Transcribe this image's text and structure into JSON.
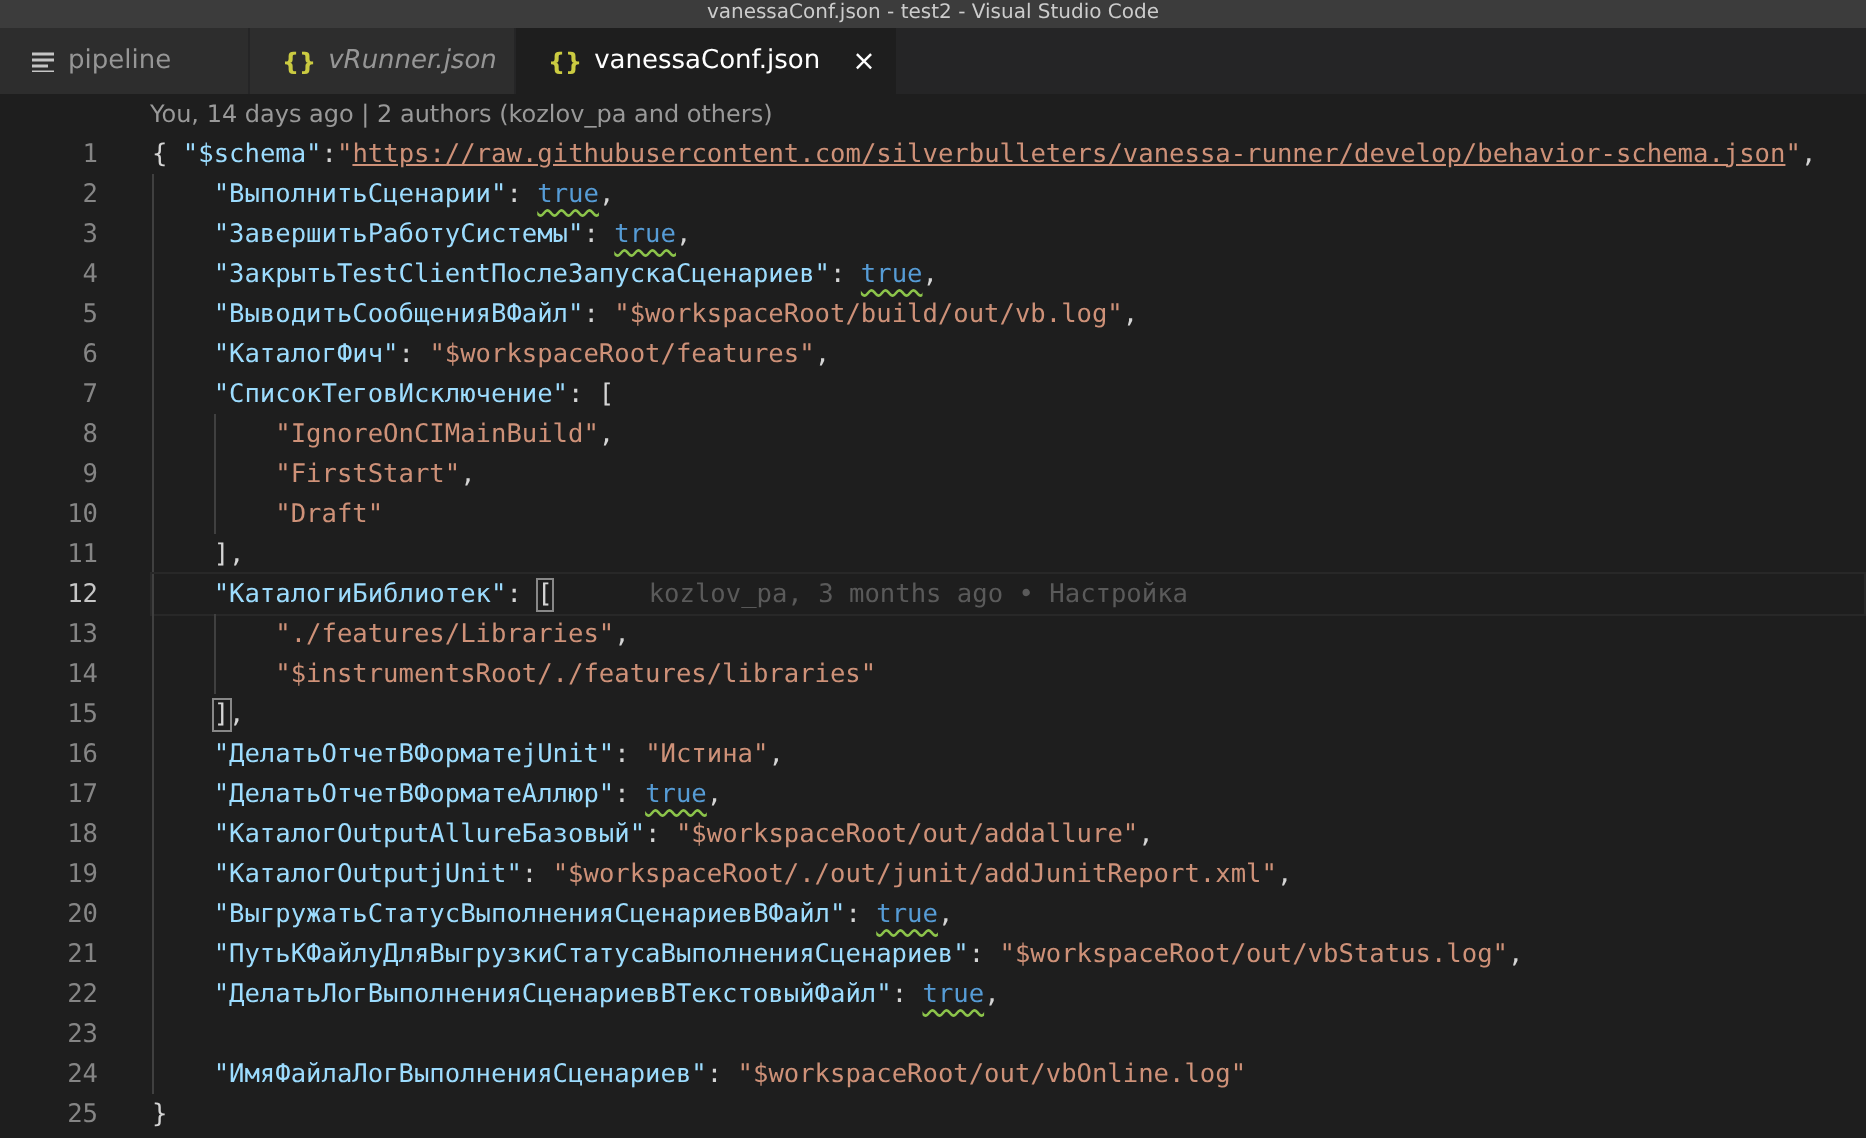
{
  "window": {
    "title": "vanessaConf.json - test2 - Visual Studio Code"
  },
  "tabs": [
    {
      "kind": "text",
      "label": "pipeline",
      "selected": false,
      "preview": false
    },
    {
      "kind": "json",
      "icon": "{}",
      "label": "vRunner.json",
      "selected": false,
      "preview": true
    },
    {
      "kind": "json",
      "icon": "{}",
      "label": "vanessaConf.json",
      "selected": true,
      "preview": false,
      "close": "×"
    }
  ],
  "editor": {
    "blame_header": "You, 14 days ago | 2 authors (kozlov_pa and others)",
    "lines": [
      {
        "number": "1",
        "current": false,
        "tokens": [
          {
            "kind": "punct",
            "text": "{ "
          },
          {
            "kind": "key",
            "text": "\"$schema\""
          },
          {
            "kind": "punct",
            "text": ":"
          },
          {
            "kind": "string",
            "text": "\""
          },
          {
            "kind": "link",
            "text": "https://raw.githubusercontent.com/silverbulleters/vanessa-runner/develop/behavior-schema.json"
          },
          {
            "kind": "string",
            "text": "\""
          },
          {
            "kind": "punct",
            "text": ","
          }
        ],
        "children": [
          {
            "number": "2",
            "current": false,
            "tokens": [
              {
                "kind": "key",
                "text": "\"ВыполнитьСценарии\""
              },
              {
                "kind": "punct",
                "text": ": "
              },
              {
                "kind": "bool",
                "text": "true",
                "squiggle": true
              },
              {
                "kind": "punct",
                "text": ","
              }
            ]
          },
          {
            "number": "3",
            "current": false,
            "tokens": [
              {
                "kind": "key",
                "text": "\"ЗавершитьРаботуСистемы\""
              },
              {
                "kind": "punct",
                "text": ": "
              },
              {
                "kind": "bool",
                "text": "true",
                "squiggle": true
              },
              {
                "kind": "punct",
                "text": ","
              }
            ]
          },
          {
            "number": "4",
            "current": false,
            "tokens": [
              {
                "kind": "key",
                "text": "\"ЗакрытьTestClientПослеЗапускаСценариев\""
              },
              {
                "kind": "punct",
                "text": ": "
              },
              {
                "kind": "bool",
                "text": "true",
                "squiggle": true
              },
              {
                "kind": "punct",
                "text": ","
              }
            ]
          },
          {
            "number": "5",
            "current": false,
            "tokens": [
              {
                "kind": "key",
                "text": "\"ВыводитьСообщенияВФайл\""
              },
              {
                "kind": "punct",
                "text": ": "
              },
              {
                "kind": "string",
                "text": "\"$workspaceRoot/build/out/vb.log\""
              },
              {
                "kind": "punct",
                "text": ","
              }
            ]
          },
          {
            "number": "6",
            "current": false,
            "tokens": [
              {
                "kind": "key",
                "text": "\"КаталогФич\""
              },
              {
                "kind": "punct",
                "text": ": "
              },
              {
                "kind": "string",
                "text": "\"$workspaceRoot/features\""
              },
              {
                "kind": "punct",
                "text": ","
              }
            ]
          },
          {
            "number": "7",
            "current": false,
            "tokens": [
              {
                "kind": "key",
                "text": "\"СписокТеговИсключение\""
              },
              {
                "kind": "punct",
                "text": ": ["
              }
            ],
            "children": [
              {
                "number": "8",
                "current": false,
                "tokens": [
                  {
                    "kind": "string",
                    "text": "\"IgnoreOnCIMainBuild\""
                  },
                  {
                    "kind": "punct",
                    "text": ","
                  }
                ]
              },
              {
                "number": "9",
                "current": false,
                "tokens": [
                  {
                    "kind": "string",
                    "text": "\"FirstStart\""
                  },
                  {
                    "kind": "punct",
                    "text": ","
                  }
                ]
              },
              {
                "number": "10",
                "current": false,
                "tokens": [
                  {
                    "kind": "string",
                    "text": "\"Draft\""
                  }
                ]
              }
            ]
          },
          {
            "number": "11",
            "current": false,
            "tokens": [
              {
                "kind": "punct",
                "text": "],"
              }
            ]
          },
          {
            "number": "12",
            "current": true,
            "tokens": [
              {
                "kind": "key",
                "text": "\"КаталогиБиблиотек\""
              },
              {
                "kind": "punct",
                "text": ": "
              },
              {
                "kind": "bracket",
                "text": "[",
                "matched": true
              },
              {
                "kind": "blame",
                "text": "kozlov_pa, 3 months ago • Настройка"
              }
            ],
            "children": [
              {
                "number": "13",
                "current": false,
                "tokens": [
                  {
                    "kind": "string",
                    "text": "\"./features/Libraries\""
                  },
                  {
                    "kind": "punct",
                    "text": ","
                  }
                ]
              },
              {
                "number": "14",
                "current": false,
                "tokens": [
                  {
                    "kind": "string",
                    "text": "\"$instrumentsRoot/./features/libraries\""
                  }
                ]
              }
            ]
          },
          {
            "number": "15",
            "current": false,
            "tokens": [
              {
                "kind": "bracket",
                "text": "]",
                "matched": true
              },
              {
                "kind": "punct",
                "text": ","
              }
            ]
          },
          {
            "number": "16",
            "current": false,
            "tokens": [
              {
                "kind": "key",
                "text": "\"ДелатьОтчетВФорматеjUnit\""
              },
              {
                "kind": "punct",
                "text": ": "
              },
              {
                "kind": "string",
                "text": "\"Истина\""
              },
              {
                "kind": "punct",
                "text": ","
              }
            ]
          },
          {
            "number": "17",
            "current": false,
            "tokens": [
              {
                "kind": "key",
                "text": "\"ДелатьОтчетВФорматеАллюр\""
              },
              {
                "kind": "punct",
                "text": ": "
              },
              {
                "kind": "bool",
                "text": "true",
                "squiggle": true
              },
              {
                "kind": "punct",
                "text": ","
              }
            ]
          },
          {
            "number": "18",
            "current": false,
            "tokens": [
              {
                "kind": "key",
                "text": "\"КаталогOutputAllureБазовый\""
              },
              {
                "kind": "punct",
                "text": ": "
              },
              {
                "kind": "string",
                "text": "\"$workspaceRoot/out/addallure\""
              },
              {
                "kind": "punct",
                "text": ","
              }
            ]
          },
          {
            "number": "19",
            "current": false,
            "tokens": [
              {
                "kind": "key",
                "text": "\"КаталогOutputjUnit\""
              },
              {
                "kind": "punct",
                "text": ": "
              },
              {
                "kind": "string",
                "text": "\"$workspaceRoot/./out/junit/addJunitReport.xml\""
              },
              {
                "kind": "punct",
                "text": ","
              }
            ]
          },
          {
            "number": "20",
            "current": false,
            "tokens": [
              {
                "kind": "key",
                "text": "\"ВыгружатьСтатусВыполненияСценариевВФайл\""
              },
              {
                "kind": "punct",
                "text": ": "
              },
              {
                "kind": "bool",
                "text": "true",
                "squiggle": true
              },
              {
                "kind": "punct",
                "text": ","
              }
            ]
          },
          {
            "number": "21",
            "current": false,
            "tokens": [
              {
                "kind": "key",
                "text": "\"ПутьКФайлуДляВыгрузкиСтатусаВыполненияСценариев\""
              },
              {
                "kind": "punct",
                "text": ": "
              },
              {
                "kind": "string",
                "text": "\"$workspaceRoot/out/vbStatus.log\""
              },
              {
                "kind": "punct",
                "text": ","
              }
            ]
          },
          {
            "number": "22",
            "current": false,
            "tokens": [
              {
                "kind": "key",
                "text": "\"ДелатьЛогВыполненияСценариевВТекстовыйФайл\""
              },
              {
                "kind": "punct",
                "text": ": "
              },
              {
                "kind": "bool",
                "text": "true",
                "squiggle": true
              },
              {
                "kind": "punct",
                "text": ","
              }
            ]
          },
          {
            "number": "23",
            "current": false
          },
          {
            "number": "24",
            "current": false,
            "tokens": [
              {
                "kind": "key",
                "text": "\"ИмяФайлаЛогВыполненияСценариев\""
              },
              {
                "kind": "punct",
                "text": ": "
              },
              {
                "kind": "string",
                "text": "\"$workspaceRoot/out/vbOnline.log\""
              }
            ]
          }
        ]
      },
      {
        "number": "25",
        "current": false,
        "tokens": [
          {
            "kind": "punct",
            "text": "}"
          }
        ]
      }
    ]
  }
}
